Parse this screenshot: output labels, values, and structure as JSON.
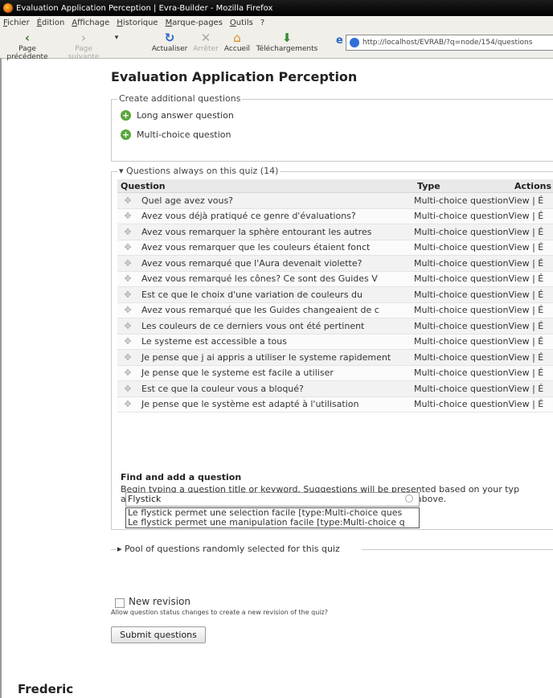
{
  "browser": {
    "window_title": "Evaluation Application Perception | Evra-Builder - Mozilla Firefox",
    "menu": [
      "Fichier",
      "Édition",
      "Affichage",
      "Historique",
      "Marque-pages",
      "Outils",
      "?"
    ],
    "toolbar": {
      "back": "Page précédente",
      "forward": "Page suivante",
      "reload": "Actualiser",
      "stop": "Arrêter",
      "home": "Accueil",
      "downloads": "Téléchargements"
    },
    "url": "http://localhost/EVRAB/?q=node/154/questions"
  },
  "page": {
    "title": "Evaluation Application Perception",
    "create": {
      "legend": "Create additional questions",
      "long_answer": "Long answer question",
      "multi_choice": "Multi-choice question"
    },
    "questions": {
      "legend": "Questions always on this quiz (14)",
      "headers": {
        "question": "Question",
        "type": "Type",
        "actions": "Actions"
      },
      "rows": [
        {
          "question": "Quel age avez vous?",
          "type": "Multi-choice question",
          "actions": "View | É"
        },
        {
          "question": "Avez vous déjà pratiqué ce genre d'évaluations?",
          "type": "Multi-choice question",
          "actions": "View | É"
        },
        {
          "question": "Avez vous remarquer la sphère entourant les autres",
          "type": "Multi-choice question",
          "actions": "View | É"
        },
        {
          "question": "Avez vous remarquer que les couleurs étaient fonct",
          "type": "Multi-choice question",
          "actions": "View | É"
        },
        {
          "question": "Avez vous remarqué que l'Aura devenait violette?",
          "type": "Multi-choice question",
          "actions": "View | É"
        },
        {
          "question": "Avez vous remarqué les cônes? Ce sont des Guides V",
          "type": "Multi-choice question",
          "actions": "View | É"
        },
        {
          "question": "Est ce que le choix d'une variation de couleurs du",
          "type": "Multi-choice question",
          "actions": "View | É"
        },
        {
          "question": "Avez vous remarqué que les Guides changeaient de c",
          "type": "Multi-choice question",
          "actions": "View | É"
        },
        {
          "question": "Les couleurs de ce derniers vous ont été pertinent",
          "type": "Multi-choice question",
          "actions": "View | É"
        },
        {
          "question": "Le systeme est accessible a tous",
          "type": "Multi-choice question",
          "actions": "View | É"
        },
        {
          "question": "Je pense que j ai appris a utiliser le systeme rapidement",
          "type": "Multi-choice question",
          "actions": "View | É"
        },
        {
          "question": "Je pense que le systeme est facile a utiliser",
          "type": "Multi-choice question",
          "actions": "View | É"
        },
        {
          "question": "Est ce que la couleur vous a bloqué?",
          "type": "Multi-choice question",
          "actions": "View | É"
        },
        {
          "question": "Je pense que le système est adapté à l'utilisation",
          "type": "Multi-choice question",
          "actions": "View | É"
        }
      ]
    },
    "find": {
      "title": "Find and add a question",
      "help_line1": "Begin typing a question title or keyword. Suggestions will be presented based on your typ",
      "help_line2": "add a new question, use the \"Create additional questions\" section above.",
      "value": "Flystick",
      "suggestions": [
        "Le flystick permet une selection facile [type:Multi-choice ques",
        "Le flystick permet une manipulation facile [type:Multi-choice q"
      ]
    },
    "pool_legend": "Pool of questions randomly selected for this quiz",
    "revision": {
      "label": "New revision",
      "help": "Allow question status changes to create a new revision of the quiz?"
    },
    "submit_label": "Submit questions",
    "footer_name": "Frederic"
  }
}
